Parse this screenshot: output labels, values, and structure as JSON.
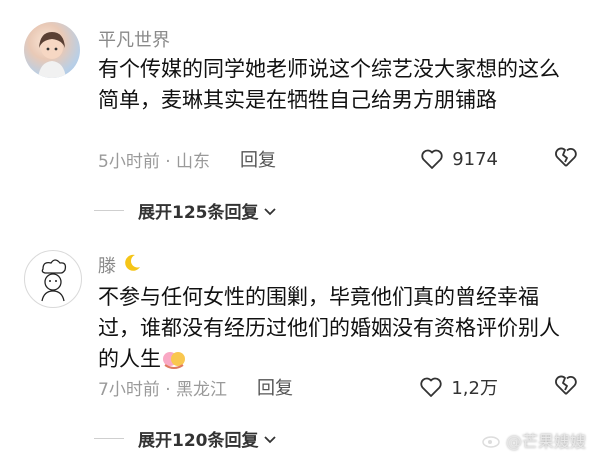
{
  "comments": [
    {
      "username": "平凡世界",
      "text": "有个传媒的同学她老师说这个综艺没大家想的这么简单，麦琳其实是在牺牲自己给男方朋铺路",
      "time_location": "5小时前 · 山东",
      "reply_label": "回复",
      "likes": "9174",
      "expand_label": "展开125条回复"
    },
    {
      "username": "滕",
      "text": "不参与任何女性的围剿，毕竟他们真的曾经幸福过，谁都没有经历过他们的婚姻没有资格评价别人的人生",
      "time_location": "7小时前 · 黑龙江",
      "reply_label": "回复",
      "likes": "1,2万",
      "expand_label": "展开120条回复"
    }
  ],
  "watermark": "@芒果嫂嫂",
  "icons": [
    "heart-icon",
    "broken-heart-icon",
    "chevron-down-icon",
    "moon-icon",
    "hug-emoji-icon",
    "weibo-logo-icon"
  ]
}
